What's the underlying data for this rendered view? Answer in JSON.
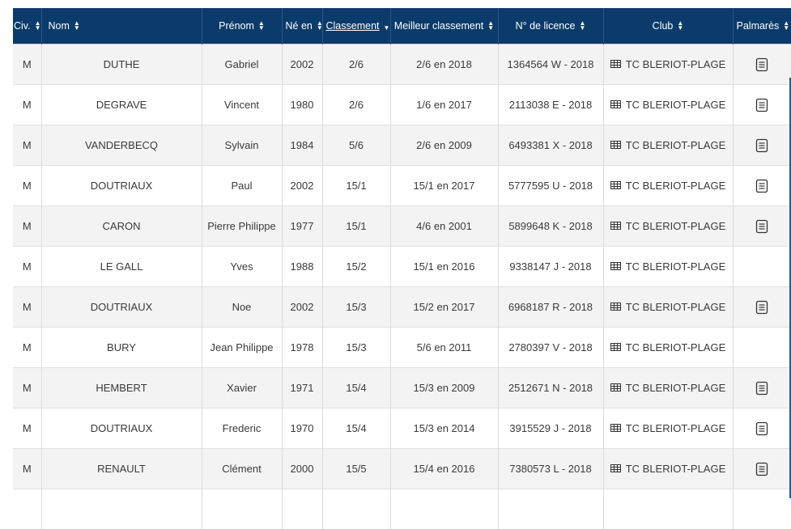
{
  "columns": {
    "civ": "Civ.",
    "nom": "Nom",
    "prenom": "Prénom",
    "ne_en": "Né en",
    "classement": "Classement",
    "meilleur": "Meilleur classement",
    "licence": "N° de licence",
    "club": "Club",
    "palmares": "Palmarès"
  },
  "sorted_column": "classement",
  "colors": {
    "header_bg": "#0b3b6a",
    "row_alt": "#f3f3f3",
    "text": "#3a3a3a"
  },
  "icons": {
    "sort": "sort-updown-icon",
    "club": "table-grid-icon",
    "palmares": "document-list-icon"
  },
  "rows": [
    {
      "civ": "M",
      "nom": "DUTHE",
      "prenom": "Gabriel",
      "ne_en": "2002",
      "classement": "2/6",
      "meilleur": "2/6 en 2018",
      "licence": "1364564 W - 2018",
      "club": "TC BLERIOT-PLAGE",
      "palmares": true
    },
    {
      "civ": "M",
      "nom": "DEGRAVE",
      "prenom": "Vincent",
      "ne_en": "1980",
      "classement": "2/6",
      "meilleur": "1/6 en 2017",
      "licence": "2113038 E - 2018",
      "club": "TC BLERIOT-PLAGE",
      "palmares": true
    },
    {
      "civ": "M",
      "nom": "VANDERBECQ",
      "prenom": "Sylvain",
      "ne_en": "1984",
      "classement": "5/6",
      "meilleur": "2/6 en 2009",
      "licence": "6493381 X - 2018",
      "club": "TC BLERIOT-PLAGE",
      "palmares": true
    },
    {
      "civ": "M",
      "nom": "DOUTRIAUX",
      "prenom": "Paul",
      "ne_en": "2002",
      "classement": "15/1",
      "meilleur": "15/1 en 2017",
      "licence": "5777595 U - 2018",
      "club": "TC BLERIOT-PLAGE",
      "palmares": true
    },
    {
      "civ": "M",
      "nom": "CARON",
      "prenom": "Pierre Philippe",
      "ne_en": "1977",
      "classement": "15/1",
      "meilleur": "4/6 en 2001",
      "licence": "5899648 K - 2018",
      "club": "TC BLERIOT-PLAGE",
      "palmares": true
    },
    {
      "civ": "M",
      "nom": "LE GALL",
      "prenom": "Yves",
      "ne_en": "1988",
      "classement": "15/2",
      "meilleur": "15/1 en 2016",
      "licence": "9338147 J - 2018",
      "club": "TC BLERIOT-PLAGE",
      "palmares": false
    },
    {
      "civ": "M",
      "nom": "DOUTRIAUX",
      "prenom": "Noe",
      "ne_en": "2002",
      "classement": "15/3",
      "meilleur": "15/2 en 2017",
      "licence": "6968187 R - 2018",
      "club": "TC BLERIOT-PLAGE",
      "palmares": true
    },
    {
      "civ": "M",
      "nom": "BURY",
      "prenom": "Jean Philippe",
      "ne_en": "1978",
      "classement": "15/3",
      "meilleur": "5/6 en 2011",
      "licence": "2780397 V - 2018",
      "club": "TC BLERIOT-PLAGE",
      "palmares": false
    },
    {
      "civ": "M",
      "nom": "HEMBERT",
      "prenom": "Xavier",
      "ne_en": "1971",
      "classement": "15/4",
      "meilleur": "15/3 en 2009",
      "licence": "2512671 N - 2018",
      "club": "TC BLERIOT-PLAGE",
      "palmares": true
    },
    {
      "civ": "M",
      "nom": "DOUTRIAUX",
      "prenom": "Frederic",
      "ne_en": "1970",
      "classement": "15/4",
      "meilleur": "15/3 en 2014",
      "licence": "3915529 J - 2018",
      "club": "TC BLERIOT-PLAGE",
      "palmares": true
    },
    {
      "civ": "M",
      "nom": "RENAULT",
      "prenom": "Clément",
      "ne_en": "2000",
      "classement": "15/5",
      "meilleur": "15/4 en 2016",
      "licence": "7380573 L - 2018",
      "club": "TC BLERIOT-PLAGE",
      "palmares": true
    }
  ]
}
